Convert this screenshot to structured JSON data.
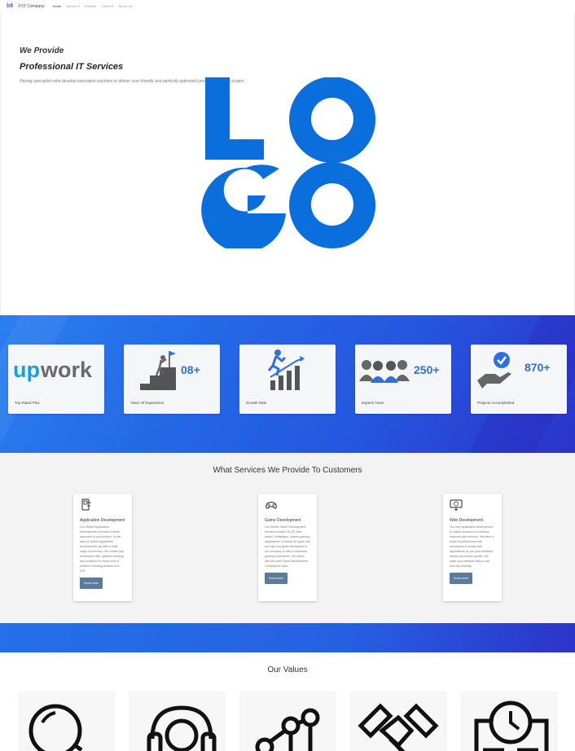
{
  "nav": {
    "brand": "XYZ Company",
    "links": [
      {
        "label": "Home",
        "dropdown": false
      },
      {
        "label": "Service",
        "dropdown": true
      },
      {
        "label": "Portfolio",
        "dropdown": false
      },
      {
        "label": "Career",
        "dropdown": true
      },
      {
        "label": "About US",
        "dropdown": false
      }
    ]
  },
  "hero": {
    "line1": "We Provide",
    "line2": "Professional IT Services",
    "tagline": "Having specialists who develop innovative solutions to deliver user friendly and perfectly optimized products for every project.",
    "logo_lines": [
      "LO",
      "GO"
    ]
  },
  "stats": {
    "cards": [
      {
        "label": "Top Rated Plus",
        "value": "",
        "logo_text": "Upwork"
      },
      {
        "label": "Years Of Experience",
        "value": "08+"
      },
      {
        "label": "Growth Rate",
        "value": ""
      },
      {
        "label": "Experts Team",
        "value": "250+"
      },
      {
        "label": "Projects Accomplished",
        "value": "870+"
      }
    ]
  },
  "services": {
    "title": "What Services We Provide To Customers",
    "cards": [
      {
        "title": "Application Development",
        "description": "Our Mobile Application Development provides a better approach to your project. In this area of mobile application development, we offer a wide range of services. Our mobile app developers offer optimum strategy and solutions for every kind of platform including Android and iOS.",
        "button": "Know more"
      },
      {
        "title": "Game Development",
        "description": "Our Mobile Game Development service includes 2D-3D, web based, multiplayer, custom gaming applications in almost all types. We put high end game developers in our company to offer a seamless gaming experience. Get hands with the best Game Development Company in India.",
        "button": "Know more"
      },
      {
        "title": "Web Development",
        "description": "Our web application development is mainly focused on providing supreme web solution. We have a team of professional web developers to create web applications as per your business needs and market growth. We make your website easy to use and user friendly.",
        "button": "Know more"
      }
    ]
  },
  "values": {
    "title": "Our Values",
    "icons": [
      "magnifier-icon",
      "headset-icon",
      "network-chart-icon",
      "handshake-icon",
      "time-document-icon"
    ]
  },
  "colors": {
    "brand_blue": "#2f6fe0",
    "logo_blue": "#0a6fdc",
    "button_gray_blue": "#5c7a99"
  }
}
